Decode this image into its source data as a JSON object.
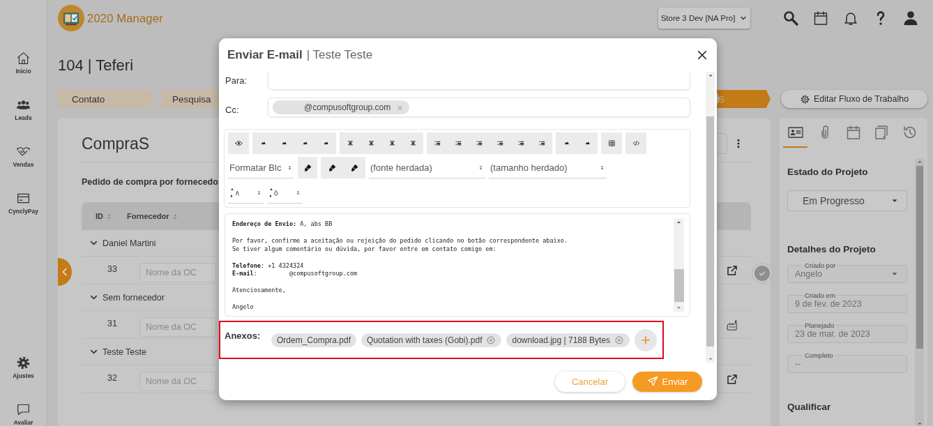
{
  "app": {
    "name": "2020 Manager"
  },
  "sidebar": {
    "items": [
      {
        "label": "Inicio",
        "kind": "home"
      },
      {
        "label": "Leads",
        "kind": "people"
      },
      {
        "label": "Vendas",
        "kind": "handshake"
      },
      {
        "label": "CynclyPay",
        "kind": "card"
      }
    ],
    "bottom_items": [
      {
        "label": "Ajustes",
        "kind": "gear"
      },
      {
        "label": "Avaliar",
        "kind": "chat"
      }
    ]
  },
  "header": {
    "store": "Store 3 Dev [NA Pro]"
  },
  "project": {
    "title": "104 | Teferi"
  },
  "workflow": {
    "stages": [
      {
        "label": "Contato",
        "selected": false
      },
      {
        "label": "Pesquisa",
        "selected": false
      },
      {
        "label": "S",
        "selected": true
      }
    ],
    "edit_button": "Editar Fluxo de Trabalho"
  },
  "purchases": {
    "title": "CompraS",
    "subtitle": "Pedido de compra por fornecedo",
    "columns": [
      "ID",
      "Fornecedor"
    ],
    "groups": [
      {
        "name": "Daniel Martini",
        "expanded": true,
        "rows": [
          {
            "id": "33",
            "placeholder": "Nome da OC",
            "kind": "link"
          }
        ]
      },
      {
        "name": "Sem fornecedor",
        "expanded": true,
        "rows": [
          {
            "id": "31",
            "placeholder": "Nome da OC",
            "kind": "factory"
          }
        ]
      },
      {
        "name": "Teste Teste",
        "expanded": true,
        "rows": [
          {
            "id": "32",
            "placeholder": "Nome da OC",
            "kind": "link"
          }
        ]
      }
    ]
  },
  "side_panel": {
    "tabs": [
      {
        "kind": "contact",
        "selected": true
      },
      {
        "kind": "attachment",
        "selected": false
      },
      {
        "kind": "calendar",
        "selected": false
      },
      {
        "kind": "notes",
        "selected": false
      },
      {
        "kind": "history",
        "selected": false
      }
    ],
    "status_heading": "Estado do Projeto",
    "status": "Em Progresso",
    "details_heading": "Detalhes do Projeto",
    "fields": [
      {
        "label": "Criado por",
        "value": "Angelo",
        "kind": "select"
      },
      {
        "label": "Criado em",
        "value": "9 de fev. de 2023",
        "kind": "text"
      },
      {
        "label": "Planejado",
        "value": "23 de mar. de 2023",
        "kind": "text"
      },
      {
        "label": "Completo",
        "value": "--",
        "kind": "text"
      }
    ],
    "next_heading": "Qualificar"
  },
  "email_dialog": {
    "title": "Enviar E-mail",
    "subtitle": "| Teste Teste",
    "to_label": "Para:",
    "cc_label": "Cc:",
    "cc_chips": [
      "@compusoftgroup.com"
    ],
    "editor": {
      "block_format": "Formatar Blc",
      "font": "(fonte herdada)",
      "size": "(tamanho herdado)",
      "body": [
        [
          "**Endereço de Envio:** A, abs BB"
        ],
        [
          "Por favor, confirme a aceitação ou rejeição do pedido clicando no botão correspondente abaixo.",
          "Se tiver algum comentário ou dúvida, por favor entre em contato comigo em:"
        ],
        [
          "**Telefone**: +1 4324324",
          "**E-mail**:         @compusoftgroup.com"
        ],
        [
          "Atenciosamente,"
        ],
        [
          "Angelo"
        ]
      ]
    },
    "attachments_label": "Anexos:",
    "attachments": [
      {
        "name": "Ordem_Compra.pdf",
        "removable": false
      },
      {
        "name": "Quotation with taxes (Gobi).pdf",
        "removable": true
      },
      {
        "name": "download.jpg | 7188 Bytes",
        "removable": true
      }
    ],
    "cancel": "Cancelar",
    "send": "Enviar"
  }
}
